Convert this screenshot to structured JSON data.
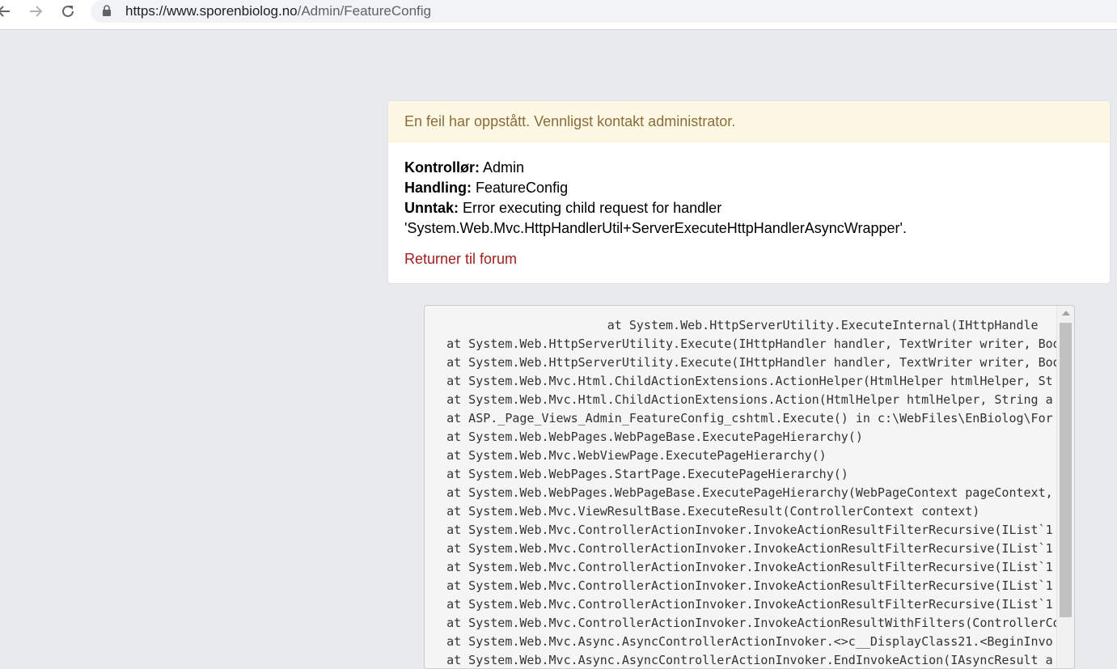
{
  "browser": {
    "url_host": "https://www.sporenbiolog.no",
    "url_path": "/Admin/FeatureConfig"
  },
  "error": {
    "header": "En feil har oppstått. Vennligst kontakt administrator.",
    "controller_label": "Kontrollør:",
    "controller_value": "Admin",
    "action_label": "Handling:",
    "action_value": "FeatureConfig",
    "exception_label": "Unntak:",
    "exception_value_line1": "Error executing child request for handler",
    "exception_value_line2": "'System.Web.Mvc.HttpHandlerUtil+ServerExecuteHttpHandlerAsyncWrapper'.",
    "return_link": "Returner til forum"
  },
  "stack_trace": [
    "                         at System.Web.HttpServerUtility.ExecuteInternal(IHttpHandle",
    "   at System.Web.HttpServerUtility.Execute(IHttpHandler handler, TextWriter writer, Boo",
    "   at System.Web.HttpServerUtility.Execute(IHttpHandler handler, TextWriter writer, Boo",
    "   at System.Web.Mvc.Html.ChildActionExtensions.ActionHelper(HtmlHelper htmlHelper, St",
    "   at System.Web.Mvc.Html.ChildActionExtensions.Action(HtmlHelper htmlHelper, String a",
    "   at ASP._Page_Views_Admin_FeatureConfig_cshtml.Execute() in c:\\WebFiles\\EnBiolog\\For",
    "   at System.Web.WebPages.WebPageBase.ExecutePageHierarchy()",
    "   at System.Web.Mvc.WebViewPage.ExecutePageHierarchy()",
    "   at System.Web.WebPages.StartPage.ExecutePageHierarchy()",
    "   at System.Web.WebPages.WebPageBase.ExecutePageHierarchy(WebPageContext pageContext,",
    "   at System.Web.Mvc.ViewResultBase.ExecuteResult(ControllerContext context)",
    "   at System.Web.Mvc.ControllerActionInvoker.InvokeActionResultFilterRecursive(IList`1",
    "   at System.Web.Mvc.ControllerActionInvoker.InvokeActionResultFilterRecursive(IList`1",
    "   at System.Web.Mvc.ControllerActionInvoker.InvokeActionResultFilterRecursive(IList`1",
    "   at System.Web.Mvc.ControllerActionInvoker.InvokeActionResultFilterRecursive(IList`1",
    "   at System.Web.Mvc.ControllerActionInvoker.InvokeActionResultFilterRecursive(IList`1",
    "   at System.Web.Mvc.ControllerActionInvoker.InvokeActionResultWithFilters(ControllerCo",
    "   at System.Web.Mvc.Async.AsyncControllerActionInvoker.<>c__DisplayClass21.<BeginInvo",
    "   at System.Web.Mvc.Async.AsyncControllerActionInvoker.EndInvokeAction(IAsyncResult a"
  ],
  "icons": {
    "back": "back-arrow-icon",
    "forward": "forward-arrow-icon",
    "reload": "reload-icon",
    "lock": "lock-icon"
  },
  "colors": {
    "page_bg": "#e9eaee",
    "alert_bg": "#fcf8e3",
    "alert_text": "#8a6d3b",
    "link": "#a01e1e"
  }
}
